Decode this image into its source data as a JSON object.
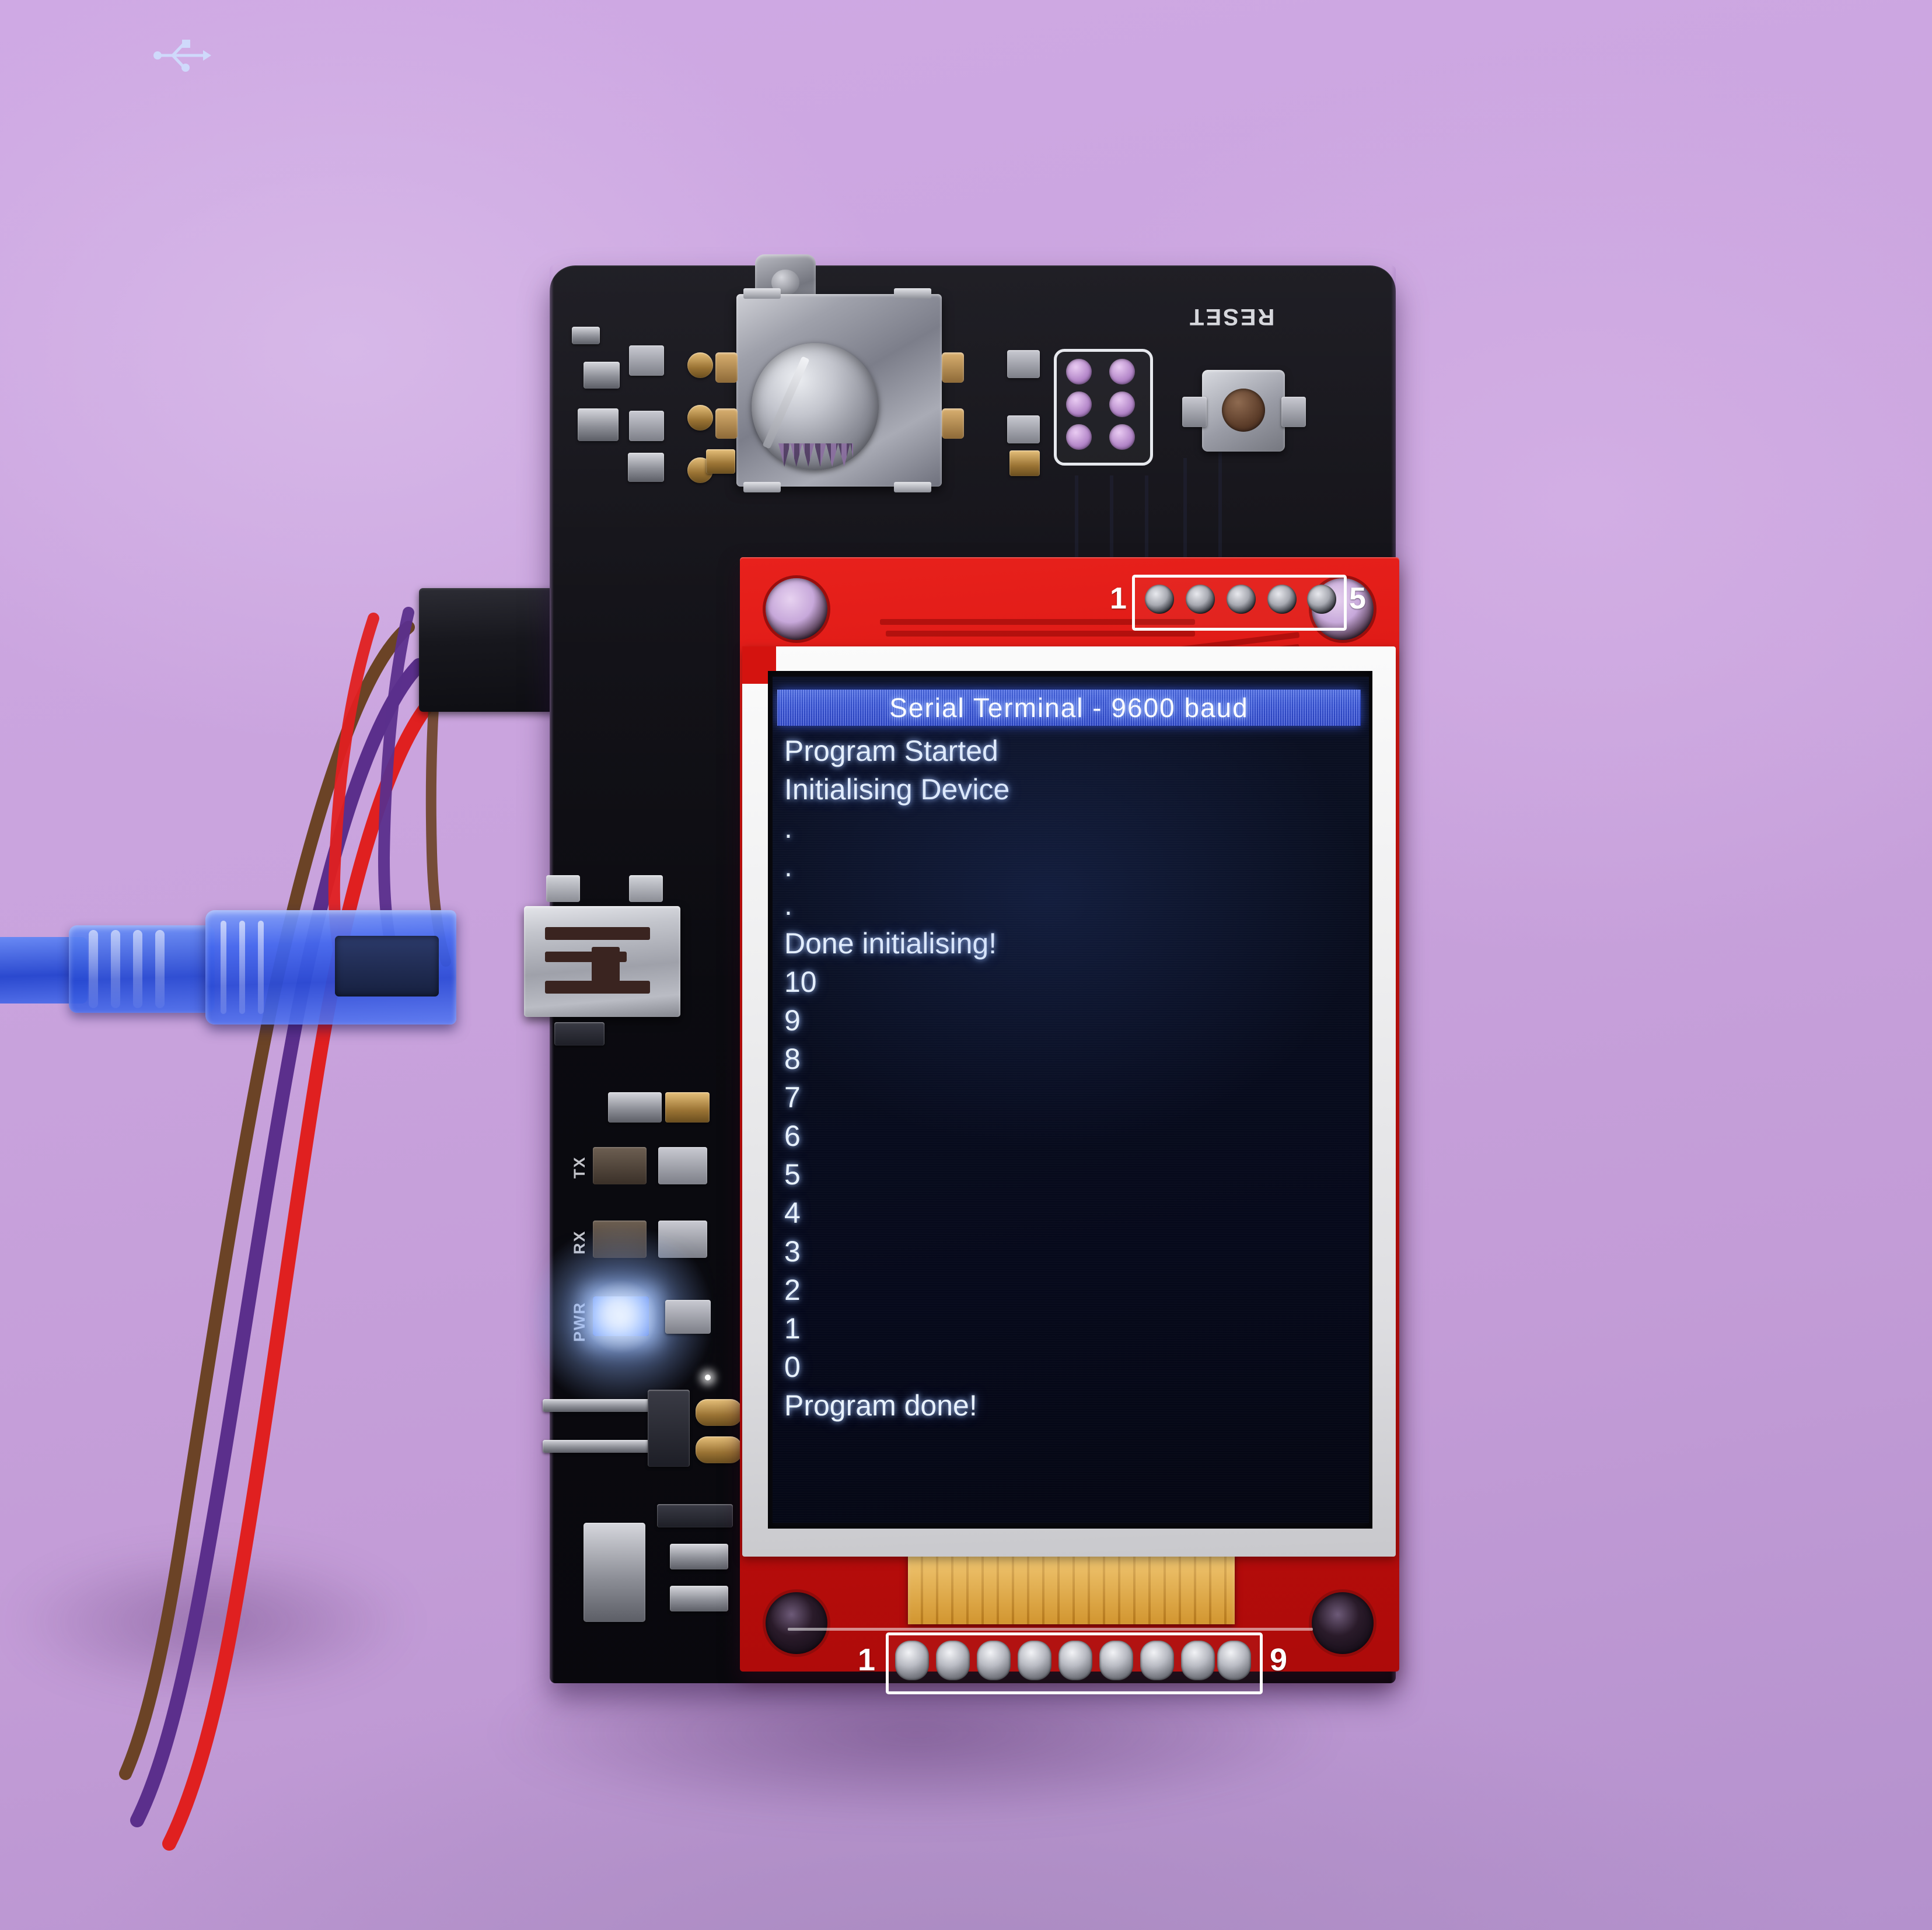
{
  "scene": {
    "title": "Arduino rotary-encoder board with red TFT LCD breakout showing a serial terminal",
    "background_color": "#c9a5dd"
  },
  "display": {
    "title_bar": {
      "text": "Serial Terminal - 9600 baud",
      "background_color": "#3553dd",
      "text_color": "#ffffff"
    },
    "background_color": "#060a1c",
    "text_color": "#e8f2ff",
    "lines": [
      "Program Started",
      "Initialising Device",
      ".",
      ".",
      ".",
      "Done initialising!",
      "10",
      "9",
      "8",
      "7",
      "6",
      "5",
      "4",
      "3",
      "2",
      "1",
      "0",
      "Program done!"
    ]
  },
  "tft_board": {
    "color": "#d4130f",
    "top_header": {
      "first_pin_label": "1",
      "last_pin_label": "5",
      "pin_count": 5
    },
    "bottom_header": {
      "first_pin_label": "1",
      "last_pin_label": "9",
      "pin_count": 9
    },
    "flex_cable_color": "#e8a735"
  },
  "main_board": {
    "color": "#0b0a10",
    "reset_label": "RESET",
    "led_labels": [
      "TX",
      "RX",
      "PWR"
    ],
    "power_led_state": "on",
    "tx_led_state": "off",
    "rx_led_state": "off",
    "usb_connector": "mini-usb"
  },
  "cable": {
    "usb_plug_color": "#3a5fe0",
    "jumper_wire_colors": [
      "#6b4326",
      "#5b2f8c",
      "#e02020"
    ]
  },
  "icons": {
    "usb_trident": "usb-icon",
    "rotary_encoder": "knob-icon",
    "reset_button": "button-icon"
  }
}
